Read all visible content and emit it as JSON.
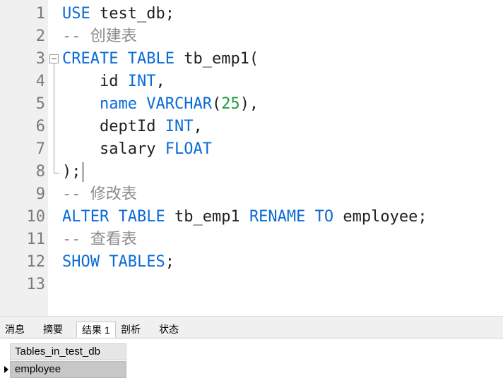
{
  "editor": {
    "line_numbers": [
      "1",
      "2",
      "3",
      "4",
      "5",
      "6",
      "7",
      "8",
      "9",
      "10",
      "11",
      "12",
      "13"
    ],
    "lines": [
      {
        "tokens": [
          {
            "t": "USE",
            "c": "kw"
          },
          {
            "t": " test_db;",
            "c": ""
          }
        ]
      },
      {
        "tokens": [
          {
            "t": "-- 创建表",
            "c": "cm"
          }
        ]
      },
      {
        "tokens": [
          {
            "t": "CREATE",
            "c": "kw"
          },
          {
            "t": " ",
            "c": ""
          },
          {
            "t": "TABLE",
            "c": "kw"
          },
          {
            "t": " tb_emp1(",
            "c": ""
          }
        ]
      },
      {
        "tokens": [
          {
            "t": "    id ",
            "c": ""
          },
          {
            "t": "INT",
            "c": "kw"
          },
          {
            "t": ",",
            "c": ""
          }
        ]
      },
      {
        "tokens": [
          {
            "t": "    ",
            "c": ""
          },
          {
            "t": "name",
            "c": "kw"
          },
          {
            "t": " ",
            "c": ""
          },
          {
            "t": "VARCHAR",
            "c": "kw"
          },
          {
            "t": "(",
            "c": ""
          },
          {
            "t": "25",
            "c": "num"
          },
          {
            "t": "),",
            "c": ""
          }
        ]
      },
      {
        "tokens": [
          {
            "t": "    deptId ",
            "c": ""
          },
          {
            "t": "INT",
            "c": "kw"
          },
          {
            "t": ",",
            "c": ""
          }
        ]
      },
      {
        "tokens": [
          {
            "t": "    salary ",
            "c": ""
          },
          {
            "t": "FLOAT",
            "c": "kw"
          }
        ]
      },
      {
        "tokens": [
          {
            "t": ");",
            "c": ""
          }
        ]
      },
      {
        "tokens": [
          {
            "t": "-- 修改表",
            "c": "cm"
          }
        ]
      },
      {
        "tokens": [
          {
            "t": "ALTER",
            "c": "kw"
          },
          {
            "t": " ",
            "c": ""
          },
          {
            "t": "TABLE",
            "c": "kw"
          },
          {
            "t": " tb_emp1 ",
            "c": ""
          },
          {
            "t": "RENAME",
            "c": "kw"
          },
          {
            "t": " ",
            "c": ""
          },
          {
            "t": "TO",
            "c": "kw"
          },
          {
            "t": " employee;",
            "c": ""
          }
        ]
      },
      {
        "tokens": [
          {
            "t": "-- 查看表",
            "c": "cm"
          }
        ]
      },
      {
        "tokens": [
          {
            "t": "SHOW",
            "c": "kw"
          },
          {
            "t": " ",
            "c": ""
          },
          {
            "t": "TABLES",
            "c": "kw"
          },
          {
            "t": ";",
            "c": ""
          }
        ]
      },
      {
        "tokens": []
      }
    ]
  },
  "tabs": [
    {
      "label": "消息",
      "active": false
    },
    {
      "label": "摘要",
      "active": false
    },
    {
      "label": "结果 1",
      "active": true
    },
    {
      "label": "剖析",
      "active": false
    },
    {
      "label": "状态",
      "active": false
    }
  ],
  "results": {
    "column_header": "Tables_in_test_db",
    "rows": [
      "employee"
    ]
  },
  "colors": {
    "keyword": "#0a6bd6",
    "number": "#1d9a3a",
    "comment": "#8c8c8c",
    "text": "#1f1f1f",
    "gutter_bg": "#f0f0f0",
    "selected_cell_bg": "#c7c7c7"
  }
}
